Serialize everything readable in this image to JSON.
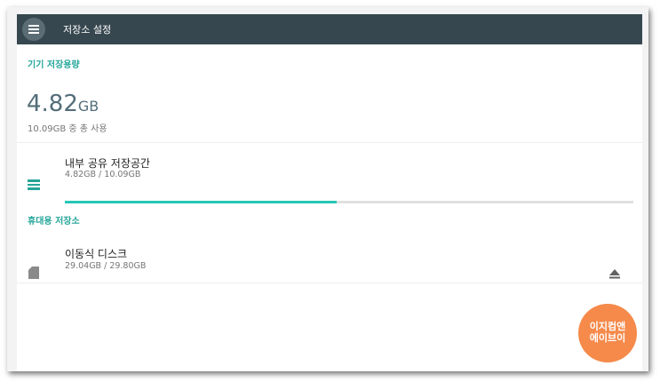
{
  "app": {
    "title": "저장소 설정"
  },
  "device_storage": {
    "section_label": "기기 저장용량",
    "used_value": "4.82",
    "used_unit": "GB",
    "summary": "10.09GB 중 총 사용"
  },
  "internal": {
    "title": "내부 공유 저장공간",
    "usage": "4.82GB / 10.09GB",
    "used_fraction": 0.478,
    "icon": "list-icon"
  },
  "portable": {
    "section_label": "휴대용 저장소",
    "items": [
      {
        "title": "이동식 디스크",
        "usage": "29.04GB / 29.80GB",
        "icon": "sd-card-icon",
        "action_icon": "eject-icon"
      }
    ]
  },
  "watermark": {
    "line1": "이지컴앤",
    "line2": "에이브이"
  },
  "colors": {
    "appbar": "#37474f",
    "accent": "#26a69a",
    "progress": "#26c6b4",
    "badge": "#f58a4b"
  }
}
